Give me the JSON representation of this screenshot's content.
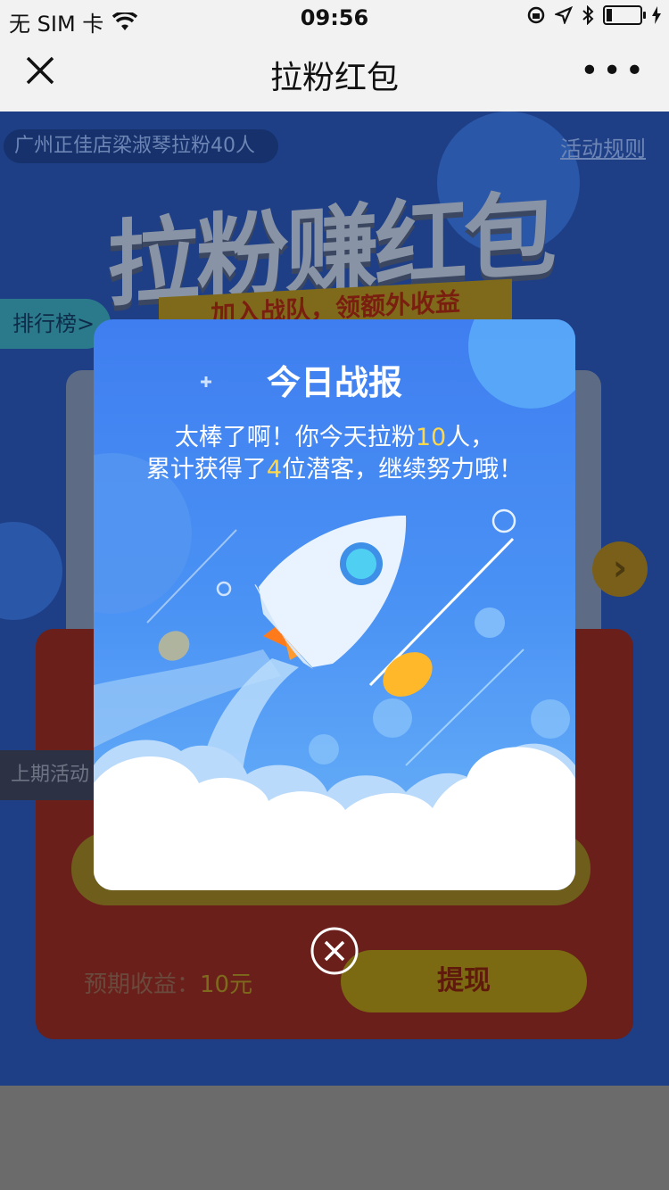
{
  "status_bar": {
    "carrier": "无 SIM 卡",
    "time": "09:56"
  },
  "nav": {
    "title": "拉粉红包"
  },
  "background": {
    "shop_tag": "广州正佳店梁淑琴拉粉40人",
    "rules_link": "活动规则",
    "hero_title": "拉粉赚红包",
    "ribbon": "加入战队，领额外收益",
    "rank_tab": "排行榜>",
    "prev_tab": "上期活动",
    "expected_label": "预期收益：",
    "expected_amount": "10元",
    "withdraw_label": "提现"
  },
  "modal": {
    "title": "今日战报",
    "line1_a": "太棒了啊！你今天拉粉",
    "line1_num": "10",
    "line1_b": "人，",
    "line2_a": "累计获得了",
    "line2_num": "4",
    "line2_b": "位潜客，继续努力哦！"
  },
  "icons": {
    "close": "close-icon",
    "more": "more-icon",
    "rocket": "rocket-illustration",
    "modal_close": "close-circle-icon"
  },
  "colors": {
    "modal_blue": "#3f7ef0",
    "highlight": "#ffd84a",
    "dim_bg": "#1e3f86"
  }
}
